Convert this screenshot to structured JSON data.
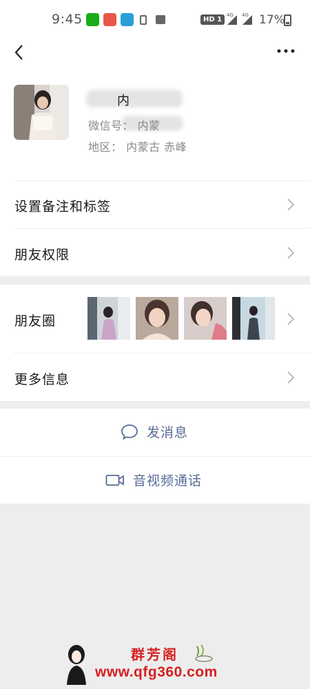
{
  "status_bar": {
    "time": "9:45",
    "hd_badge": "HD 1",
    "network_label_1": "4G",
    "network_label_2": "4G",
    "battery": "17%",
    "icons": [
      "wechat-app-icon",
      "game-app-icon",
      "wifi-app-icon",
      "sim-icon",
      "image-icon",
      "signal-icon",
      "battery-icon"
    ]
  },
  "nav": {
    "icons": [
      "back-icon",
      "more-icon"
    ]
  },
  "profile": {
    "name_visible": "内",
    "line1": "微信号：  内蒙",
    "line2": "地区：  内蒙古  赤峰"
  },
  "cells": {
    "remark": "设置备注和标签",
    "permissions": "朋友权限",
    "moments": "朋友圈",
    "more_info": "更多信息"
  },
  "actions": {
    "message": "发消息",
    "call": "音视频通话"
  },
  "watermark": {
    "title": "群芳阁",
    "url": "www.qfg360.com"
  },
  "colors": {
    "background": "#ededed",
    "link": "#576b95",
    "watermark": "#d62020"
  }
}
